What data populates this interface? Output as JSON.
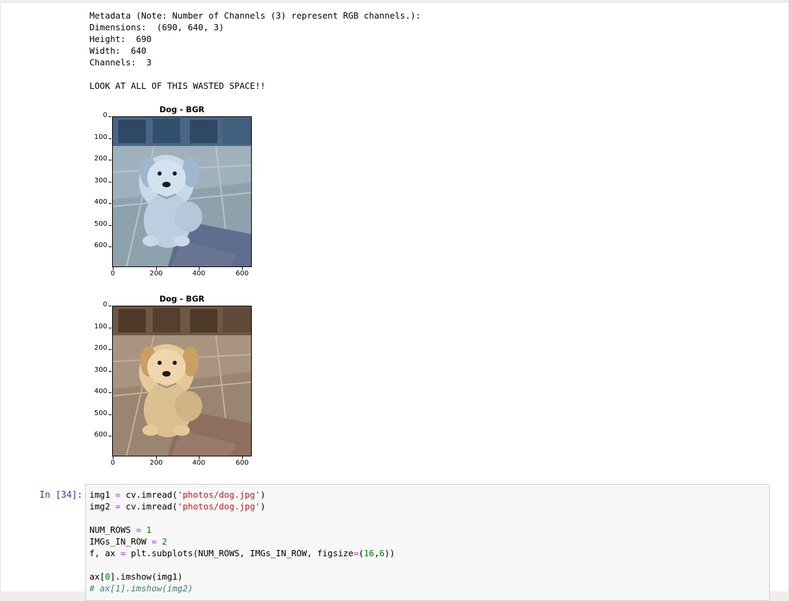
{
  "output": {
    "lines": [
      "Metadata (Note: Number of Channels (3) represent RGB channels.):",
      "Dimensions:  (690, 640, 3)",
      "Height:  690",
      "Width:  640",
      "Channels:  3",
      "",
      "LOOK AT ALL OF THIS WASTED SPACE!!"
    ]
  },
  "plots": [
    {
      "title": "Dog - BGR",
      "yticks": [
        "0",
        "100",
        "200",
        "300",
        "400",
        "500",
        "600"
      ],
      "xticks": [
        "0",
        "200",
        "400",
        "600"
      ],
      "image_description": "dog photo with BGR color order (bluish tint)"
    },
    {
      "title": "Dog - BGR",
      "yticks": [
        "0",
        "100",
        "200",
        "300",
        "400",
        "500",
        "600"
      ],
      "xticks": [
        "0",
        "200",
        "400",
        "600"
      ],
      "image_description": "dog photo with natural colors"
    }
  ],
  "cell": {
    "prompt": "In [34]:",
    "lines": {
      "l1": {
        "var": "img1",
        "op": " = ",
        "call": "cv.imread(",
        "str": "'photos/dog.jpg'",
        "close": ")"
      },
      "l2": {
        "var": "img2",
        "op": " = ",
        "call": "cv.imread(",
        "str": "'photos/dog.jpg'",
        "close": ")"
      },
      "l3": {
        "var": "NUM_ROWS",
        "op": " = ",
        "num": "1"
      },
      "l4": {
        "var": "IMGs_IN_ROW",
        "op": " = ",
        "num": "2"
      },
      "l5": {
        "a": "f, ax ",
        "op": "=",
        "b": " plt.subplots(NUM_ROWS, IMGs_IN_ROW, figsize",
        "op2": "=",
        "c": "(",
        "n1": "16",
        "d": ",",
        "n2": "6",
        "e": "))"
      },
      "l6": {
        "a": "ax[",
        "n": "0",
        "b": "].imshow(img1)"
      },
      "l7": {
        "comment": "# ax[1].imshow(img2)"
      }
    }
  },
  "colors": {
    "prompt": "#303f9f",
    "string": "#ba2121",
    "number": "#008000",
    "operator": "#aa22ff",
    "comment": "#408080"
  }
}
